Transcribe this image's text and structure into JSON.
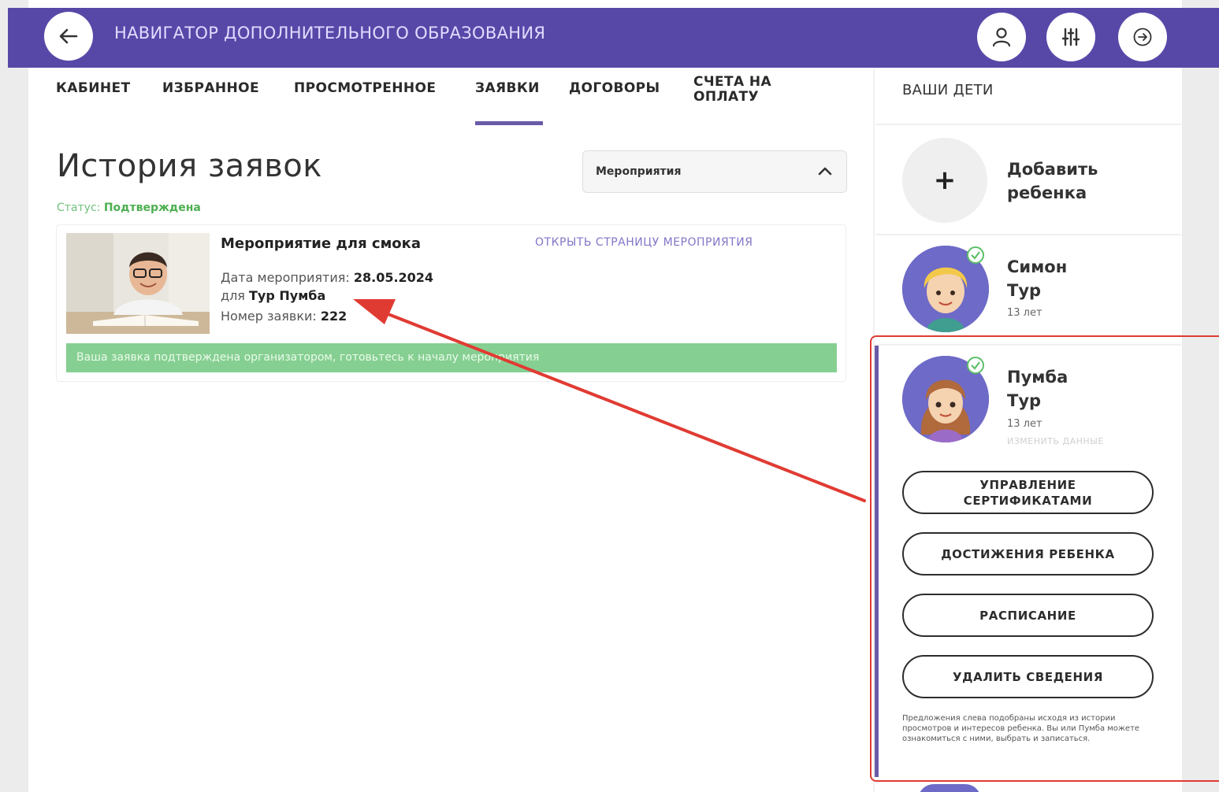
{
  "header": {
    "title": "НАВИГАТОР ДОПОЛНИТЕЛЬНОГО ОБРАЗОВАНИЯ",
    "icons": [
      "arrow-left-icon",
      "user-icon",
      "sliders-icon",
      "logout-icon"
    ]
  },
  "tabs": [
    {
      "label": "КАБИНЕТ"
    },
    {
      "label": "ИЗБРАННОЕ"
    },
    {
      "label": "ПРОСМОТРЕННОЕ"
    },
    {
      "label": "ЗАЯВКИ",
      "active": true
    },
    {
      "label": "ДОГОВОРЫ"
    },
    {
      "label": "СЧЕТА НА ОПЛАТУ"
    }
  ],
  "main": {
    "title": "История заявок",
    "status_label": "Статус:",
    "status_value": "Подтверждена",
    "filter": {
      "value": "Мероприятия"
    }
  },
  "application": {
    "title": "Мероприятие для смока",
    "open_link": "ОТКРЫТЬ СТРАНИЦУ МЕРОПРИЯТИЯ",
    "date_label": "Дата мероприятия:",
    "date_value": "28.05.2024",
    "for_label": "для",
    "for_value": "Тур Пумба",
    "number_label": "Номер заявки:",
    "number_value": "222",
    "banner": "Ваша заявка подтверждена организатором, готовьтесь к началу мероприятия"
  },
  "kids_panel": {
    "title": "ВАШИ ДЕТИ",
    "add_label_1": "Добавить",
    "add_label_2": "ребенка",
    "children": [
      {
        "first": "Симон",
        "last": "Тур",
        "age": "13 лет"
      },
      {
        "first": "Пумба",
        "last": "Тур",
        "age": "13 лет",
        "edit": "ИЗМЕНИТЬ ДАННЫЕ"
      }
    ],
    "buttons": {
      "certs_1": "УПРАВЛЕНИЕ",
      "certs_2": "СЕРТИФИКАТАМИ",
      "achievements": "ДОСТИЖЕНИЯ РЕБЕНКА",
      "schedule": "РАСПИСАНИЕ",
      "delete": "УДАЛИТЬ СВЕДЕНИЯ"
    },
    "note": "Предложения слева подобраны исходя из истории просмотров и интересов ребенка. Вы или Пумба можете ознакомиться с ними, выбрать и записаться."
  },
  "colors": {
    "header": "#5748a8",
    "accent": "#6b5aa8",
    "success": "#86cf92",
    "annotation": "#e03b33"
  }
}
